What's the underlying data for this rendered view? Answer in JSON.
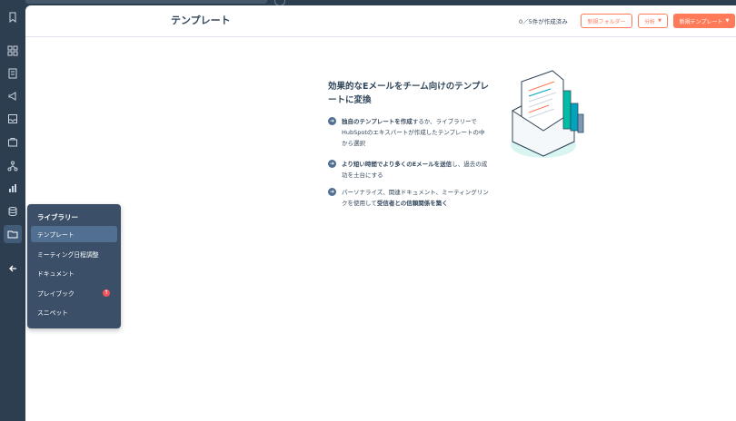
{
  "header": {
    "title": "テンプレート",
    "count_text": "0／5件が作成済み",
    "new_folder_label": "新規フォルダー",
    "analyze_label": "分析",
    "new_template_label": "新規テンプレート"
  },
  "promo": {
    "title": "効果的なEメールをチーム向けのテンプレートに変換",
    "features": [
      {
        "bold": "独自のテンプレートを作成",
        "text": "するか、ライブラリーでHubSpotのエキスパートが作成したテンプレートの中から選択"
      },
      {
        "bold": "より短い時間でより多くのEメールを送信",
        "text": "し、過去の成功を土台にする"
      },
      {
        "text": "パーソナライズ、関連ドキュメント、ミーティングリンクを使用して",
        "bold": "受信者との信頼関係を築く"
      }
    ]
  },
  "flyout": {
    "title": "ライブラリー",
    "items": [
      {
        "label": "テンプレート"
      },
      {
        "label": "ミーティング日程調整"
      },
      {
        "label": "ドキュメント"
      },
      {
        "label": "プレイブック",
        "badge": "↑"
      },
      {
        "label": "スニペット"
      }
    ]
  },
  "colors": {
    "accent": "#ff7a59",
    "sidebar": "#2d3e50",
    "flyout": "#3b5068",
    "text": "#33475b"
  },
  "sidebar_icons": [
    "bookmark-icon",
    "dashboard-icon",
    "contacts-icon",
    "megaphone-icon",
    "inbox-icon",
    "sales-icon",
    "workflow-icon",
    "reports-icon",
    "database-icon",
    "folder-icon",
    "collapse-arrow-icon"
  ]
}
